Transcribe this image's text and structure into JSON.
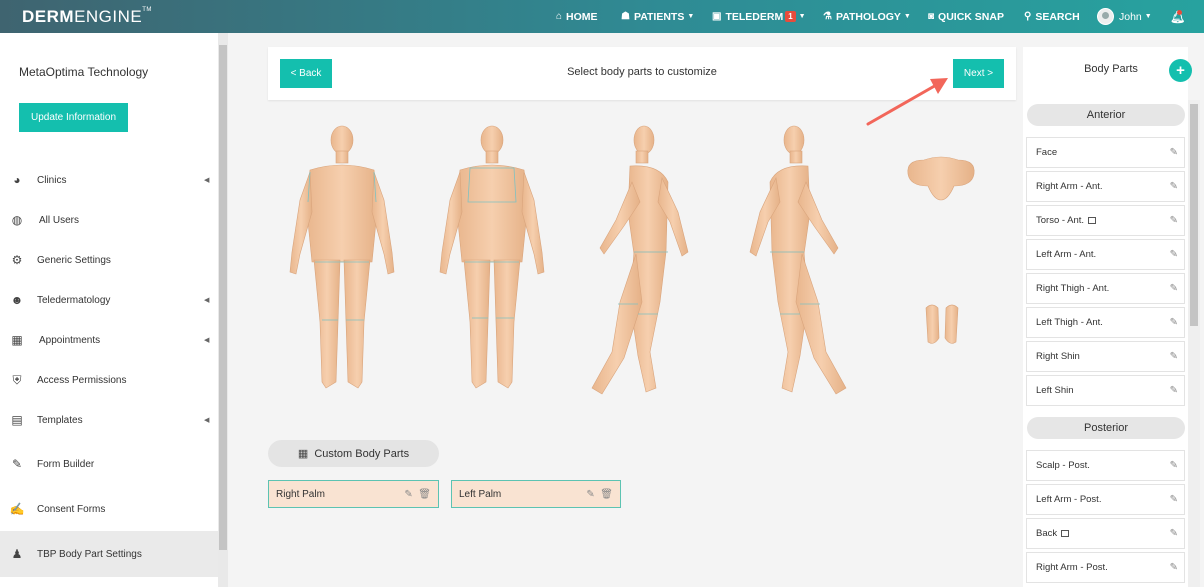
{
  "topbar": {
    "logo_bold": "DERM",
    "logo_thin": "ENGINE",
    "logo_tm": "TM",
    "nav": [
      {
        "label": "HOME",
        "icon": "home-icon"
      },
      {
        "label": "PATIENTS",
        "icon": "patients-icon"
      },
      {
        "label": "TELEDERM",
        "icon": "telederm-icon",
        "badge": "1"
      },
      {
        "label": "PATHOLOGY",
        "icon": "microscope-icon"
      },
      {
        "label": "QUICK SNAP",
        "icon": "camera-icon"
      },
      {
        "label": "SEARCH",
        "icon": "search-icon"
      }
    ],
    "user": "John",
    "accent": "#14bfae"
  },
  "sidebar": {
    "org_name": "MetaOptima Technology",
    "update_label": "Update Information",
    "items": [
      {
        "label": "Clinics",
        "icon": "pie-chart-icon",
        "arrow": true
      },
      {
        "label": "All Users",
        "icon": "users-globe-icon",
        "arrow": false
      },
      {
        "label": "Generic Settings",
        "icon": "gear-icon",
        "arrow": false
      },
      {
        "label": "Teledermatology",
        "icon": "teledermatology-icon",
        "arrow": true
      },
      {
        "label": "Appointments",
        "icon": "calendar-icon",
        "arrow": true
      },
      {
        "label": "Access Permissions",
        "icon": "shield-user-icon",
        "arrow": false
      },
      {
        "label": "Templates",
        "icon": "document-icon",
        "arrow": true
      },
      {
        "label": "Form Builder",
        "icon": "form-icon",
        "arrow": false
      },
      {
        "label": "Consent Forms",
        "icon": "consent-icon",
        "arrow": false
      },
      {
        "label": "TBP Body Part Settings",
        "icon": "body-icon",
        "arrow": false,
        "active": true
      }
    ]
  },
  "main": {
    "back_label": "< Back",
    "title": "Select body parts to customize",
    "next_label": "Next >",
    "custom_header": "Custom Body Parts",
    "custom_parts": [
      "Right Palm",
      "Left Palm"
    ]
  },
  "right_panel": {
    "title": "Body Parts",
    "add_label": "+",
    "anterior_label": "Anterior",
    "anterior": [
      {
        "label": "Face",
        "copy": false
      },
      {
        "label": "Right Arm - Ant.",
        "copy": false
      },
      {
        "label": "Torso - Ant.",
        "copy": true
      },
      {
        "label": "Left Arm - Ant.",
        "copy": false
      },
      {
        "label": "Right Thigh - Ant.",
        "copy": false
      },
      {
        "label": "Left Thigh - Ant.",
        "copy": false
      },
      {
        "label": "Right Shin",
        "copy": false
      },
      {
        "label": "Left Shin",
        "copy": false
      }
    ],
    "posterior_label": "Posterior",
    "posterior": [
      {
        "label": "Scalp - Post.",
        "copy": false
      },
      {
        "label": "Left Arm - Post.",
        "copy": false
      },
      {
        "label": "Back",
        "copy": true
      },
      {
        "label": "Right Arm - Post.",
        "copy": false
      }
    ]
  }
}
